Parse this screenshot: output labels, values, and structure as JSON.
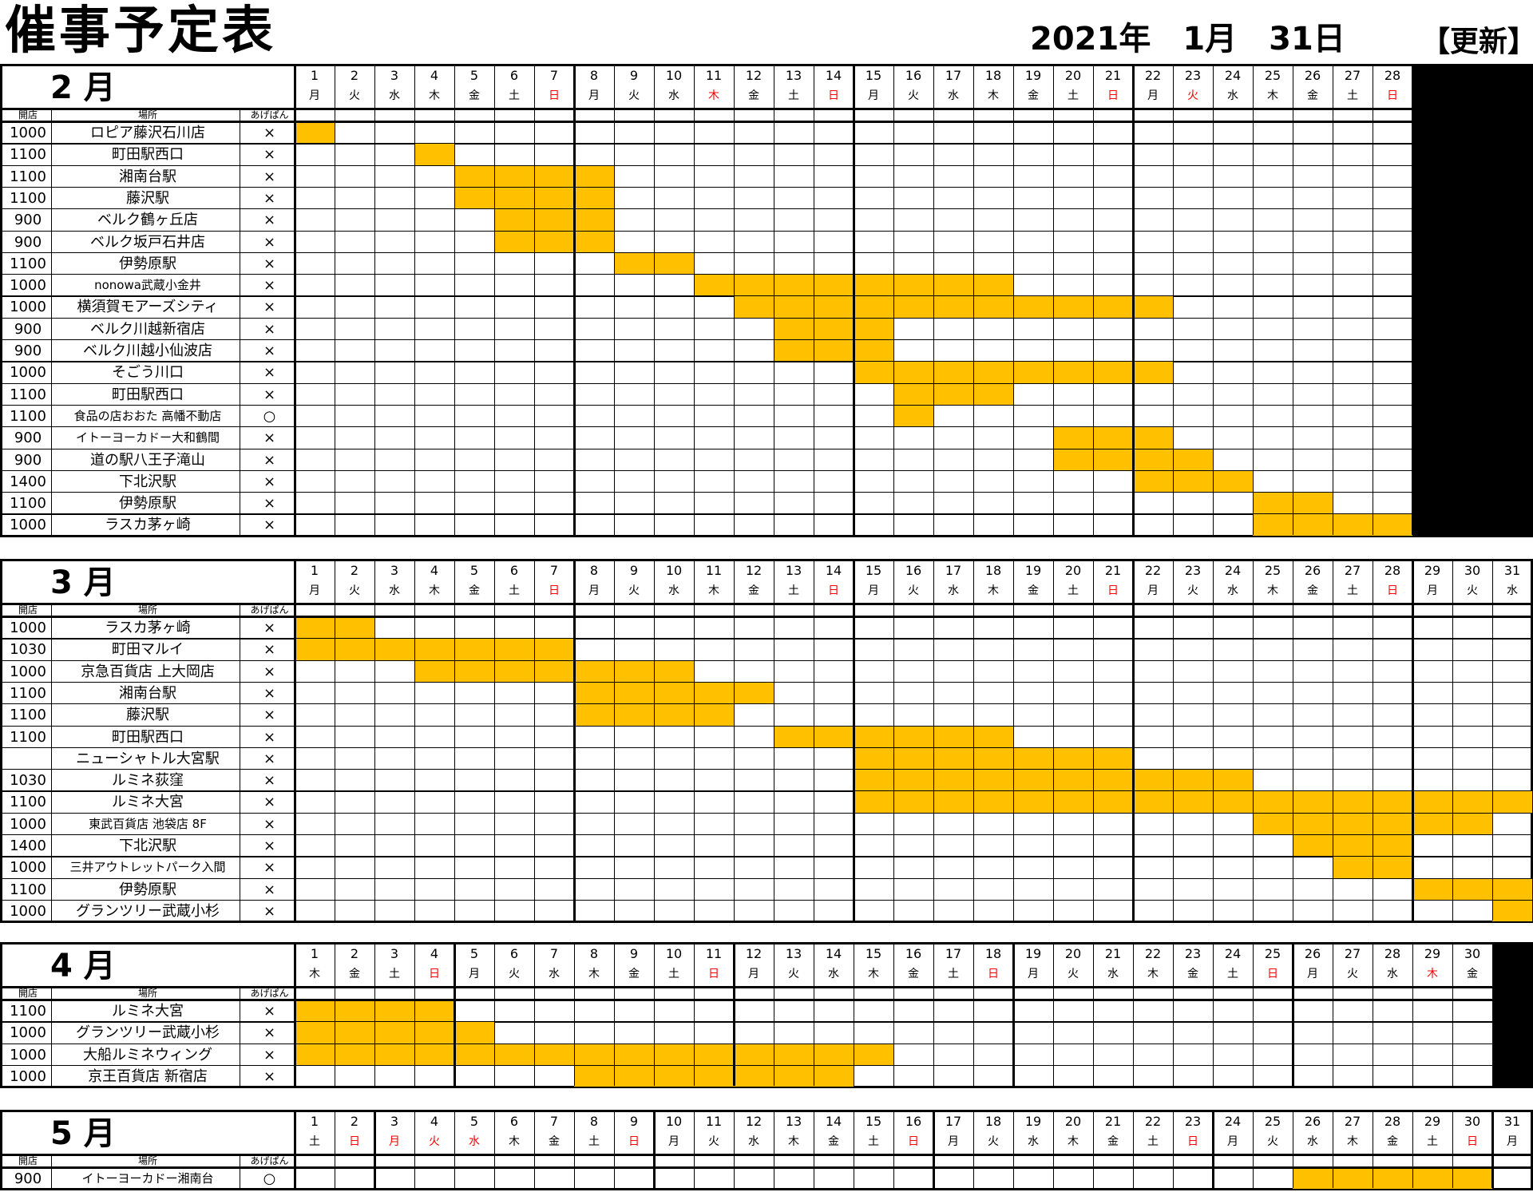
{
  "title": "催事予定表",
  "date_text": "2021年　1月　31日",
  "update_label": "【更新】",
  "header_labels": {
    "open": "開店",
    "place": "場所",
    "agepan": "あげぱん"
  },
  "colors": {
    "highlight": "#ffc000",
    "weekend_red": "#ff0000"
  },
  "months": [
    {
      "label": "2 月",
      "days": 28,
      "dow": [
        "月",
        "火",
        "水",
        "木",
        "金",
        "土",
        "日",
        "月",
        "火",
        "水",
        "木",
        "金",
        "土",
        "日",
        "月",
        "火",
        "水",
        "木",
        "金",
        "土",
        "日",
        "月",
        "火",
        "水",
        "木",
        "金",
        "土",
        "日"
      ],
      "red_days": [
        7,
        11,
        14,
        21,
        23,
        28
      ],
      "rows": [
        {
          "open": "1000",
          "place": "ロピア藤沢石川店",
          "agepan": "×",
          "span": [
            1,
            1
          ]
        },
        {
          "open": "1100",
          "place": "町田駅西口",
          "agepan": "×",
          "span": [
            4,
            4
          ]
        },
        {
          "open": "1100",
          "place": "湘南台駅",
          "agepan": "×",
          "span": [
            5,
            8
          ]
        },
        {
          "open": "1100",
          "place": "藤沢駅",
          "agepan": "×",
          "span": [
            5,
            8
          ]
        },
        {
          "open": "900",
          "place": "ベルク鶴ヶ丘店",
          "agepan": "×",
          "span": [
            6,
            8
          ]
        },
        {
          "open": "900",
          "place": "ベルク坂戸石井店",
          "agepan": "×",
          "span": [
            6,
            8
          ]
        },
        {
          "open": "1100",
          "place": "伊勢原駅",
          "agepan": "×",
          "span": [
            9,
            10
          ]
        },
        {
          "open": "1000",
          "place": "nonowa武蔵小金井",
          "agepan": "×",
          "span": [
            11,
            18
          ]
        },
        {
          "open": "1000",
          "place": "横須賀モアーズシティ",
          "agepan": "×",
          "span": [
            12,
            22
          ]
        },
        {
          "open": "900",
          "place": "ベルク川越新宿店",
          "agepan": "×",
          "span": [
            13,
            15
          ]
        },
        {
          "open": "900",
          "place": "ベルク川越小仙波店",
          "agepan": "×",
          "span": [
            13,
            15
          ]
        },
        {
          "open": "1000",
          "place": "そごう川口",
          "agepan": "×",
          "span": [
            15,
            22
          ]
        },
        {
          "open": "1100",
          "place": "町田駅西口",
          "agepan": "×",
          "span": [
            16,
            18
          ]
        },
        {
          "open": "1100",
          "place": "食品の店おおた 高幡不動店",
          "agepan": "○",
          "span": [
            16,
            16
          ]
        },
        {
          "open": "900",
          "place": "イトーヨーカドー大和鶴間",
          "agepan": "×",
          "span": [
            20,
            22
          ]
        },
        {
          "open": "900",
          "place": "道の駅八王子滝山",
          "agepan": "×",
          "span": [
            20,
            23
          ]
        },
        {
          "open": "1400",
          "place": "下北沢駅",
          "agepan": "×",
          "span": [
            22,
            24
          ]
        },
        {
          "open": "1100",
          "place": "伊勢原駅",
          "agepan": "×",
          "span": [
            25,
            26
          ]
        },
        {
          "open": "1000",
          "place": "ラスカ茅ヶ崎",
          "agepan": "×",
          "span": [
            25,
            28
          ]
        }
      ]
    },
    {
      "label": "3 月",
      "days": 31,
      "dow": [
        "月",
        "火",
        "水",
        "木",
        "金",
        "土",
        "日",
        "月",
        "火",
        "水",
        "木",
        "金",
        "土",
        "日",
        "月",
        "火",
        "水",
        "木",
        "金",
        "土",
        "日",
        "月",
        "火",
        "水",
        "木",
        "金",
        "土",
        "日",
        "月",
        "火",
        "水"
      ],
      "red_days": [
        7,
        14,
        21,
        28
      ],
      "rows": [
        {
          "open": "1000",
          "place": "ラスカ茅ヶ崎",
          "agepan": "×",
          "span": [
            1,
            2
          ]
        },
        {
          "open": "1030",
          "place": "町田マルイ",
          "agepan": "×",
          "span": [
            1,
            7
          ]
        },
        {
          "open": "1000",
          "place": "京急百貨店 上大岡店",
          "agepan": "×",
          "span": [
            4,
            10
          ]
        },
        {
          "open": "1100",
          "place": "湘南台駅",
          "agepan": "×",
          "span": [
            8,
            12
          ]
        },
        {
          "open": "1100",
          "place": "藤沢駅",
          "agepan": "×",
          "span": [
            8,
            11
          ]
        },
        {
          "open": "1100",
          "place": "町田駅西口",
          "agepan": "×",
          "span": [
            13,
            18
          ]
        },
        {
          "open": "",
          "place": "ニューシャトル大宮駅",
          "agepan": "×",
          "span": [
            15,
            21
          ]
        },
        {
          "open": "1030",
          "place": "ルミネ荻窪",
          "agepan": "×",
          "span": [
            15,
            24
          ]
        },
        {
          "open": "1100",
          "place": "ルミネ大宮",
          "agepan": "×",
          "span": [
            15,
            31
          ]
        },
        {
          "open": "1000",
          "place": "東武百貨店 池袋店 8F",
          "agepan": "×",
          "span": [
            25,
            30
          ]
        },
        {
          "open": "1400",
          "place": "下北沢駅",
          "agepan": "×",
          "span": [
            26,
            28
          ]
        },
        {
          "open": "1000",
          "place": "三井アウトレットパーク入間",
          "agepan": "×",
          "span": [
            27,
            28
          ]
        },
        {
          "open": "1100",
          "place": "伊勢原駅",
          "agepan": "×",
          "span": [
            29,
            31
          ]
        },
        {
          "open": "1000",
          "place": "グランツリー武蔵小杉",
          "agepan": "×",
          "span": [
            31,
            31
          ]
        }
      ]
    },
    {
      "label": "4 月",
      "days": 30,
      "dow": [
        "木",
        "金",
        "土",
        "日",
        "月",
        "火",
        "水",
        "木",
        "金",
        "土",
        "日",
        "月",
        "火",
        "水",
        "木",
        "金",
        "土",
        "日",
        "月",
        "火",
        "水",
        "木",
        "金",
        "土",
        "日",
        "月",
        "火",
        "水",
        "木",
        "金"
      ],
      "red_days": [
        4,
        11,
        18,
        25,
        29
      ],
      "rows": [
        {
          "open": "1100",
          "place": "ルミネ大宮",
          "agepan": "×",
          "span": [
            1,
            4
          ]
        },
        {
          "open": "1000",
          "place": "グランツリー武蔵小杉",
          "agepan": "×",
          "span": [
            1,
            5
          ]
        },
        {
          "open": "1000",
          "place": "大船ルミネウィング",
          "agepan": "×",
          "span": [
            1,
            15
          ]
        },
        {
          "open": "1000",
          "place": "京王百貨店 新宿店",
          "agepan": "×",
          "span": [
            8,
            14
          ]
        }
      ]
    },
    {
      "label": "5 月",
      "days": 31,
      "dow": [
        "土",
        "日",
        "月",
        "火",
        "水",
        "木",
        "金",
        "土",
        "日",
        "月",
        "火",
        "水",
        "木",
        "金",
        "土",
        "日",
        "月",
        "火",
        "水",
        "木",
        "金",
        "土",
        "日",
        "月",
        "火",
        "水",
        "木",
        "金",
        "土",
        "日",
        "月"
      ],
      "red_days": [
        2,
        3,
        4,
        5,
        9,
        16,
        23,
        30
      ],
      "rows": [
        {
          "open": "900",
          "place": "イトーヨーカドー湘南台",
          "agepan": "○",
          "span": [
            26,
            30
          ]
        }
      ]
    }
  ]
}
